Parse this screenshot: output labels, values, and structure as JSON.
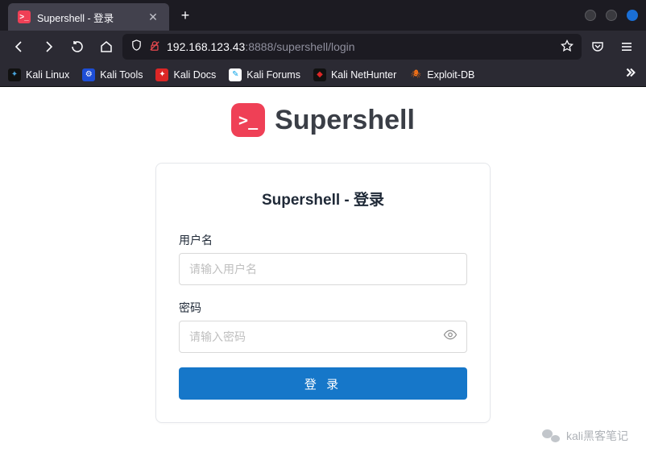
{
  "tab": {
    "title": "Supershell - 登录",
    "favicon_glyph": ">_"
  },
  "url": {
    "host": "192.168.123.43",
    "path": ":8888/supershell/login"
  },
  "bookmarks": [
    {
      "label": "Kali Linux",
      "color": "#2b2a33"
    },
    {
      "label": "Kali Tools",
      "color": "#3b82f6"
    },
    {
      "label": "Kali Docs",
      "color": "#dc2626"
    },
    {
      "label": "Kali Forums",
      "color": "#0ea5e9"
    },
    {
      "label": "Kali NetHunter",
      "color": "#dc2626"
    },
    {
      "label": "Exploit-DB",
      "color": "#f97316"
    }
  ],
  "logo": {
    "glyph": ">_",
    "text": "Supershell"
  },
  "login": {
    "title": "Supershell - 登录",
    "username_label": "用户名",
    "username_placeholder": "请输入用户名",
    "password_label": "密码",
    "password_placeholder": "请输入密码",
    "submit_label": "登 录"
  },
  "watermark": {
    "text": "kali黑客笔记"
  }
}
